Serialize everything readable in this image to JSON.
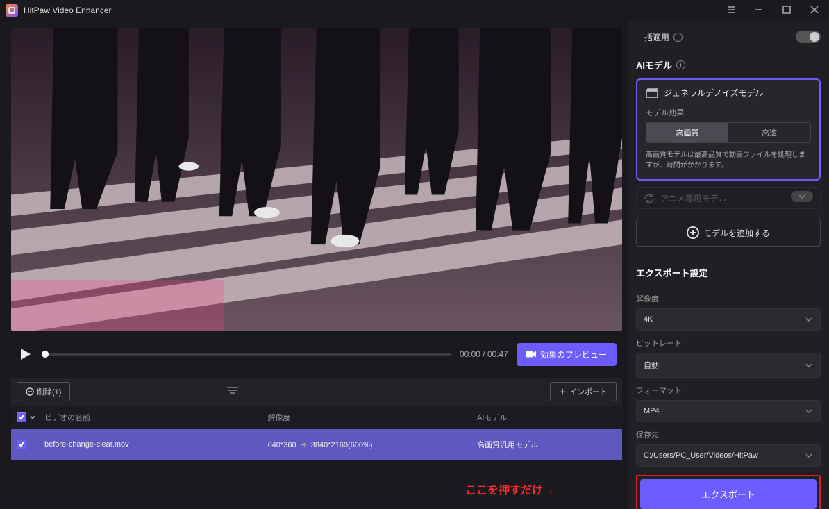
{
  "titlebar": {
    "app_name": "HitPaw Video Enhancer"
  },
  "player": {
    "time": "00:00 / 00:47",
    "preview_btn": "効果のプレビュー"
  },
  "list": {
    "delete_btn": "削除(1)",
    "import_btn": "インポート",
    "headers": {
      "name": "ビデオの名前",
      "resolution": "解像度",
      "model": "AIモデル"
    },
    "row": {
      "filename": "before-change-clear.mov",
      "src_res": "640*360",
      "dst_res": "3840*2160(600%)",
      "model": "高画質汎用モデル"
    }
  },
  "right": {
    "batch": "一括適用",
    "ai_model_title": "AIモデル",
    "model1": {
      "name": "ジェネラルデノイズモデル",
      "sub": "モデル効果",
      "hq": "高画質",
      "fast": "高速",
      "desc": "高画質モデルは最高品質で動画ファイルを処理しますが、時間がかかります。"
    },
    "model2": "アニメ専用モデル",
    "add_model": "モデルを追加する",
    "export_title": "エクスポート設定",
    "resolution_label": "解像度",
    "resolution_val": "4K",
    "bitrate_label": "ビットレート",
    "bitrate_val": "自動",
    "format_label": "フォーマット",
    "format_val": "MP4",
    "saveto_label": "保存先",
    "saveto_val": "C:/Users/PC_User/Videos/HitPaw",
    "export_btn": "エクスポート"
  },
  "annotation": "ここを押すだけ→"
}
